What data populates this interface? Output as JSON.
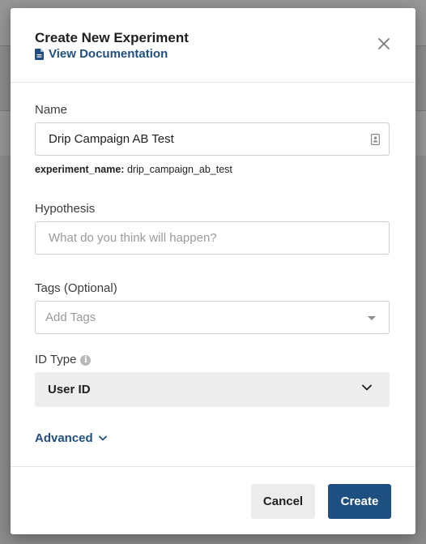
{
  "modal": {
    "title": "Create New Experiment",
    "doc_link": "View Documentation"
  },
  "name": {
    "label": "Name",
    "value": "Drip Campaign AB Test",
    "caption_key": "experiment_name:",
    "caption_value": "drip_campaign_ab_test"
  },
  "hypothesis": {
    "label": "Hypothesis",
    "placeholder": "What do you think will happen?"
  },
  "tags": {
    "label": "Tags (Optional)",
    "placeholder": "Add Tags"
  },
  "id_type": {
    "label": "ID Type",
    "selected": "User ID"
  },
  "advanced": {
    "label": "Advanced"
  },
  "footer": {
    "cancel_label": "Cancel",
    "create_label": "Create"
  },
  "colors": {
    "accent": "#1e4f81",
    "link": "#1f4f82",
    "overlay": "#8c8c8c"
  }
}
